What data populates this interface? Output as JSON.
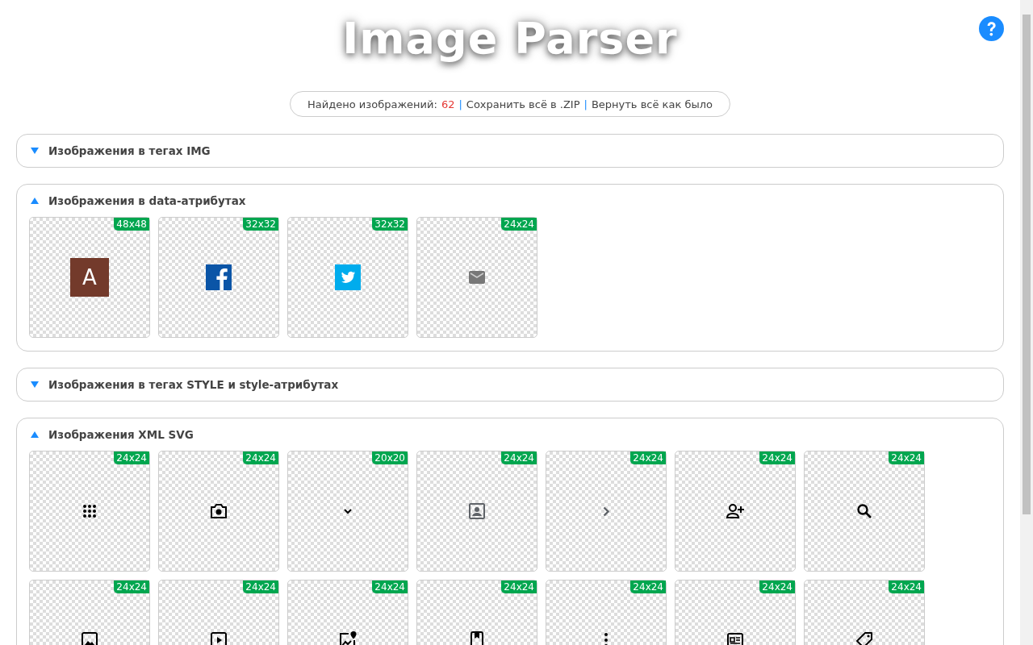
{
  "title": "Image Parser",
  "status": {
    "label": "Найдено изображений:",
    "count": "62",
    "separator": "|",
    "actions": [
      "Сохранить всё в .ZIP",
      "Вернуть всё как было"
    ]
  },
  "sections": [
    {
      "title": "Изображения в тегах IMG",
      "expanded": false
    },
    {
      "title": "Изображения в data-атрибутах",
      "expanded": true,
      "images": [
        {
          "kind": "avatar",
          "size": "48x48",
          "letter": "A"
        },
        {
          "kind": "facebook",
          "size": "32x32"
        },
        {
          "kind": "twitter",
          "size": "32x32"
        },
        {
          "kind": "mail",
          "size": "24x24"
        }
      ]
    },
    {
      "title": "Изображения в тегах STYLE и style-атрибутах",
      "expanded": false
    },
    {
      "title": "Изображения XML SVG",
      "expanded": true,
      "images": [
        {
          "kind": "grid",
          "size": "24x24"
        },
        {
          "kind": "camera",
          "size": "24x24"
        },
        {
          "kind": "chevron-down",
          "size": "20x20"
        },
        {
          "kind": "portrait",
          "size": "24x24"
        },
        {
          "kind": "chevron-right",
          "size": "24x24"
        },
        {
          "kind": "person-add",
          "size": "24x24"
        },
        {
          "kind": "search",
          "size": "24x24"
        },
        {
          "kind": "image",
          "size": "24x24"
        },
        {
          "kind": "video",
          "size": "24x24"
        },
        {
          "kind": "image-pin",
          "size": "24x24"
        },
        {
          "kind": "book",
          "size": "24x24"
        },
        {
          "kind": "dots",
          "size": "24x24"
        },
        {
          "kind": "article",
          "size": "24x24"
        },
        {
          "kind": "tag",
          "size": "24x24"
        }
      ]
    }
  ]
}
